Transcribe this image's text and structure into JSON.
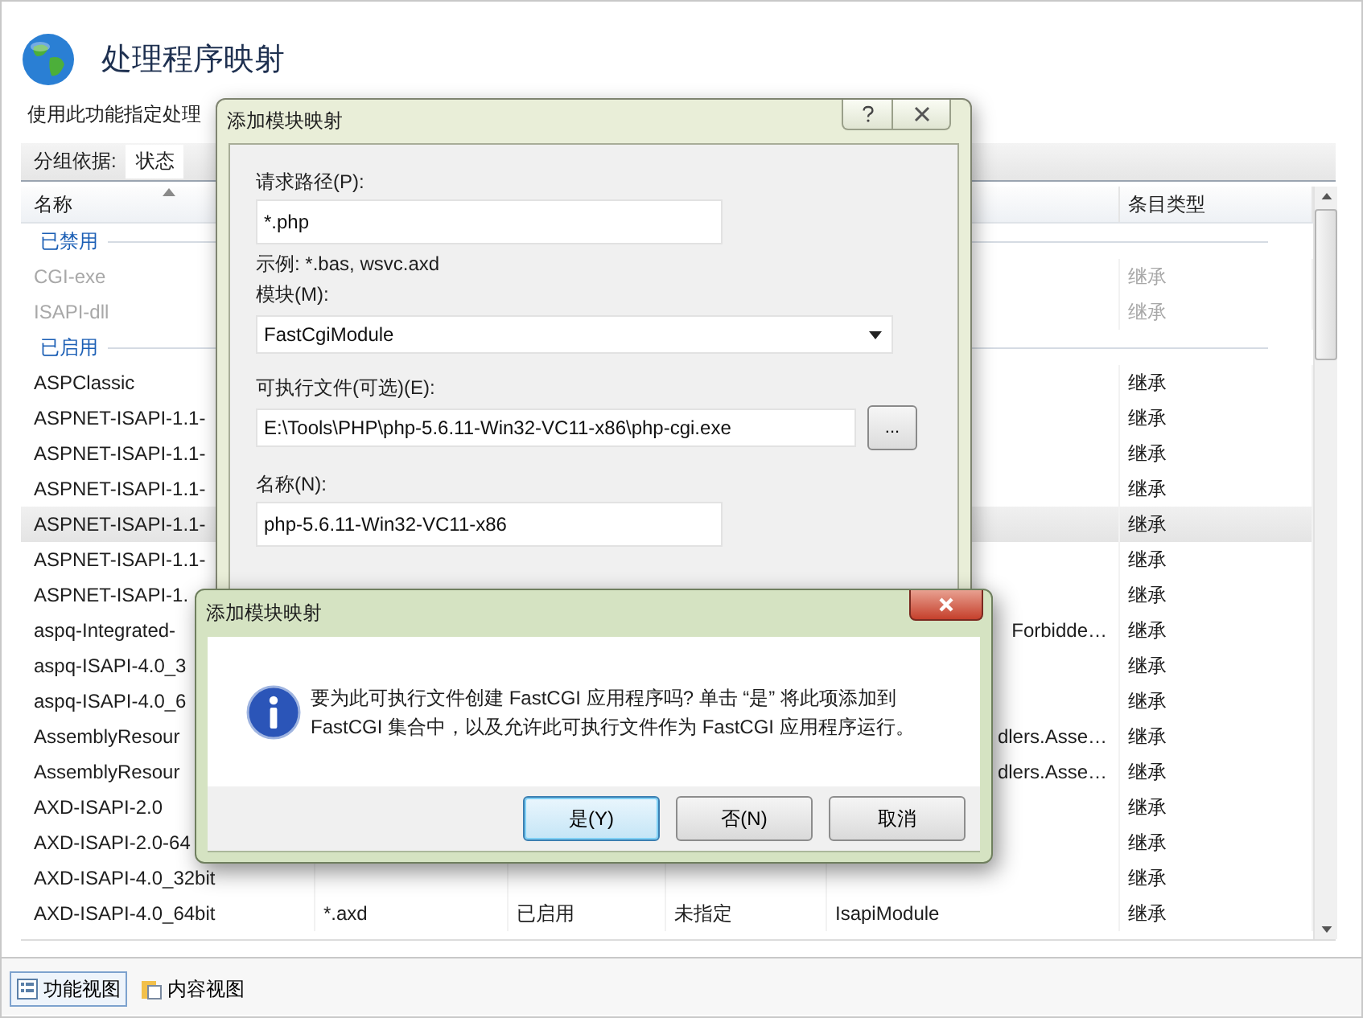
{
  "page": {
    "title": "处理程序映射",
    "description": "使用此功能指定处理"
  },
  "group_by": {
    "label": "分组依据:",
    "value": "状态"
  },
  "table": {
    "columns": {
      "name": "名称",
      "entry_type": "条目类型"
    },
    "groups": [
      {
        "label": "已禁用",
        "rows": [
          {
            "name": "CGI-exe",
            "entry_type": "继承",
            "disabled": true,
            "selected": false
          },
          {
            "name": "ISAPI-dll",
            "entry_type": "继承",
            "disabled": true,
            "selected": false
          }
        ]
      },
      {
        "label": "已启用",
        "rows": [
          {
            "name": "ASPClassic",
            "entry_type": "继承",
            "disabled": false,
            "selected": false
          },
          {
            "name": "ASPNET-ISAPI-1.1-",
            "entry_type": "继承",
            "disabled": false,
            "selected": false
          },
          {
            "name": "ASPNET-ISAPI-1.1-",
            "entry_type": "继承",
            "disabled": false,
            "selected": false
          },
          {
            "name": "ASPNET-ISAPI-1.1-",
            "entry_type": "继承",
            "disabled": false,
            "selected": false
          },
          {
            "name": "ASPNET-ISAPI-1.1-",
            "entry_type": "继承",
            "disabled": false,
            "selected": true
          },
          {
            "name": "ASPNET-ISAPI-1.1-",
            "entry_type": "继承",
            "disabled": false,
            "selected": false
          },
          {
            "name": "ASPNET-ISAPI-1.",
            "entry_type": "继承",
            "disabled": false,
            "selected": false
          },
          {
            "name": "aspq-Integrated-",
            "handler": "Forbidde…",
            "entry_type": "继承",
            "disabled": false,
            "selected": false
          },
          {
            "name": "aspq-ISAPI-4.0_3",
            "entry_type": "继承",
            "disabled": false,
            "selected": false
          },
          {
            "name": "aspq-ISAPI-4.0_6",
            "entry_type": "继承",
            "disabled": false,
            "selected": false
          },
          {
            "name": "AssemblyResour",
            "handler": "dlers.Asse…",
            "entry_type": "继承",
            "disabled": false,
            "selected": false
          },
          {
            "name": "AssemblyResour",
            "handler": "dlers.Asse…",
            "entry_type": "继承",
            "disabled": false,
            "selected": false
          },
          {
            "name": "AXD-ISAPI-2.0",
            "entry_type": "继承",
            "disabled": false,
            "selected": false
          },
          {
            "name": "AXD-ISAPI-2.0-64",
            "entry_type": "继承",
            "disabled": false,
            "selected": false
          },
          {
            "name": "AXD-ISAPI-4.0_32bit",
            "entry_type": "继承",
            "disabled": false,
            "selected": false
          },
          {
            "name": "AXD-ISAPI-4.0_64bit",
            "path": "*.axd",
            "state": "已启用",
            "column_4": "未指定",
            "handler": "IsapiModule",
            "entry_type": "继承",
            "disabled": false,
            "selected": false
          }
        ]
      }
    ]
  },
  "bottom_tabs": [
    {
      "label": "功能视图",
      "selected": true
    },
    {
      "label": "内容视图",
      "selected": false
    }
  ],
  "mapping_dialog": {
    "title": "添加模块映射",
    "request_path": {
      "label": "请求路径(P):",
      "value": "*.php",
      "hint": "示例: *.bas, wsvc.axd"
    },
    "module": {
      "label": "模块(M):",
      "value": "FastCgiModule"
    },
    "executable": {
      "label": "可执行文件(可选)(E):",
      "value": "E:\\Tools\\PHP\\php-5.6.11-Win32-VC11-x86\\php-cgi.exe",
      "browse_button": "..."
    },
    "name": {
      "label": "名称(N):",
      "value": "php-5.6.11-Win32-VC11-x86"
    }
  },
  "confirm_dialog": {
    "title": "添加模块映射",
    "message_lines": [
      "要为此可执行文件创建 FastCGI 应用程序吗? 单击 “是” 将此项添加到",
      "FastCGI 集合中，以及允许此可执行文件作为 FastCGI 应用程序运行。"
    ],
    "buttons": [
      {
        "label": "是(Y)",
        "default": true
      },
      {
        "label": "否(N)",
        "default": false
      },
      {
        "label": "取消",
        "default": false
      }
    ]
  }
}
